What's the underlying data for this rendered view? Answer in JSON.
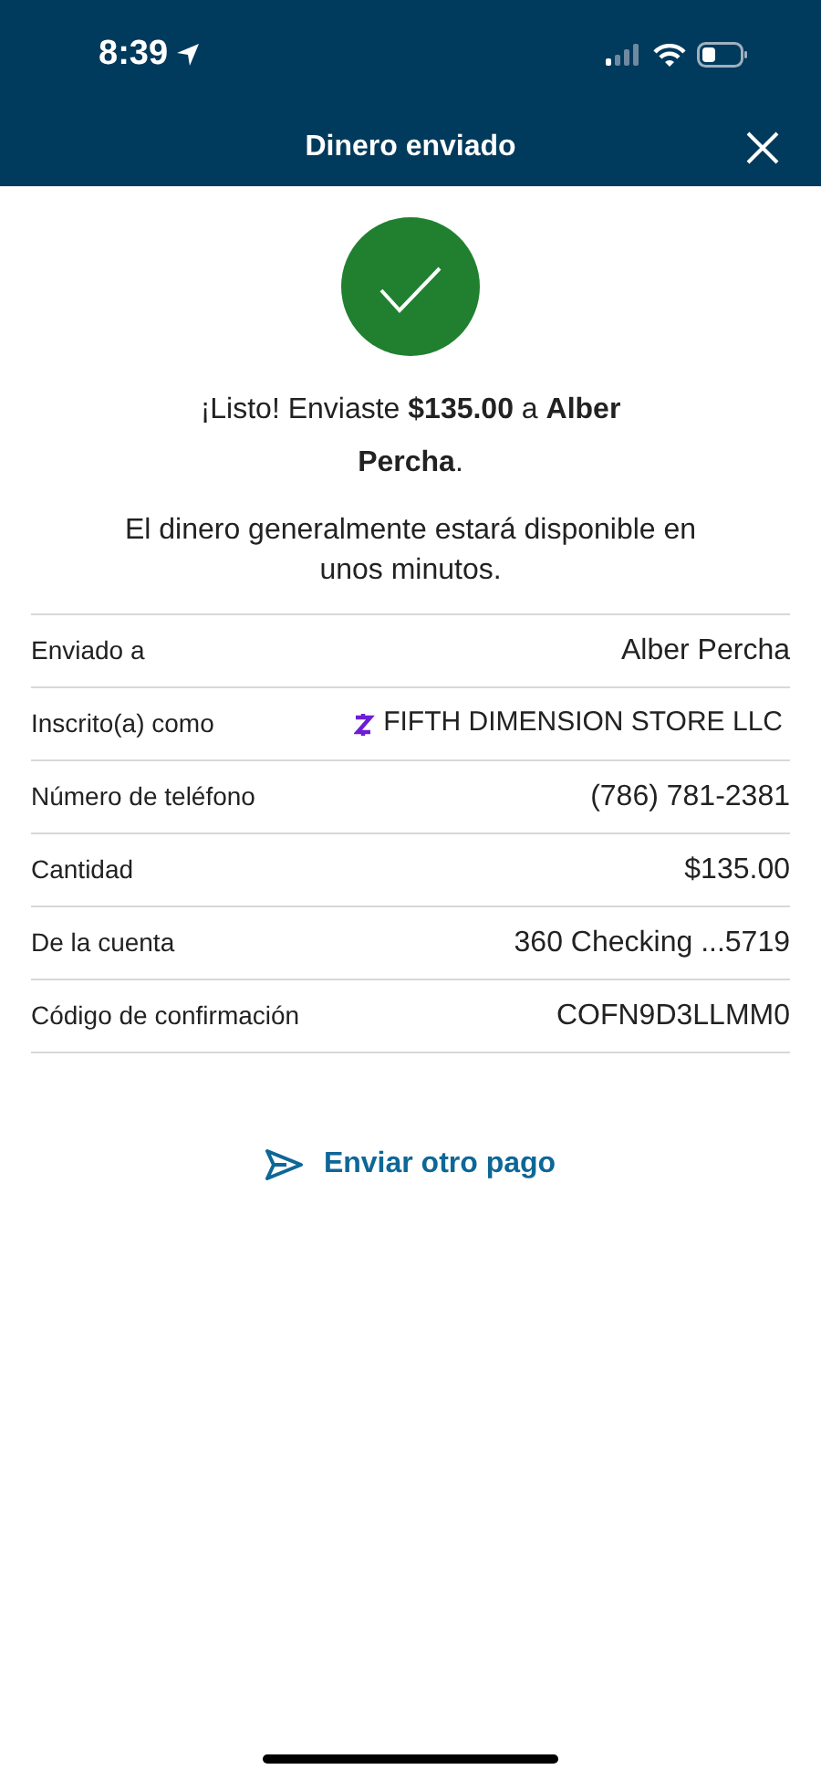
{
  "status_bar": {
    "time": "8:39"
  },
  "header": {
    "title": "Dinero enviado"
  },
  "confirmation": {
    "message": "¡Listo! Enviaste **$135.00** a **Alber Percha**.",
    "note": "El dinero generalmente estará disponible en unos minutos."
  },
  "details": [
    {
      "kind": "text",
      "label": "Enviado a",
      "value": "Alber Percha"
    },
    {
      "kind": "zelle",
      "label": "Inscrito(a) como",
      "value": "FIFTH DIMENSION STORE LLC"
    },
    {
      "kind": "text",
      "label": "Número de teléfono",
      "value": "(786) 781-2381"
    },
    {
      "kind": "text",
      "label": "Cantidad",
      "value": "$135.00"
    },
    {
      "kind": "text",
      "label": "De la cuenta",
      "value": "360 Checking ...5719"
    },
    {
      "kind": "text",
      "label": "Código de confirmación",
      "value": "COFN9D3LLMM0"
    }
  ],
  "action": {
    "label": "Enviar otro pago"
  }
}
